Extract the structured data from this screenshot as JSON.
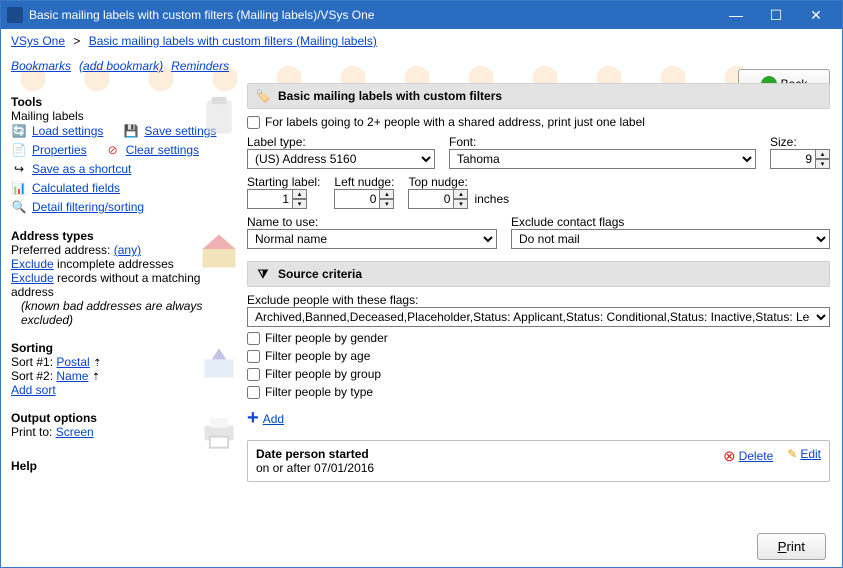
{
  "window": {
    "title": "Basic mailing labels with custom filters (Mailing labels)/VSys One"
  },
  "breadcrumb": {
    "root": "VSys One",
    "current": "Basic mailing labels with custom filters (Mailing labels)"
  },
  "bookmarks": {
    "bookmarks": "Bookmarks",
    "add": "(add bookmark)",
    "reminders": "Reminders"
  },
  "back": {
    "label": "Back"
  },
  "tools": {
    "heading": "Tools",
    "sub": "Mailing labels",
    "load": "Load settings",
    "save": "Save settings",
    "properties": "Properties",
    "clear": "Clear settings",
    "shortcut": "Save as a shortcut",
    "calc": "Calculated fields",
    "filter": "Detail filtering/sorting"
  },
  "address": {
    "heading": "Address types",
    "pref_label": "Preferred address:",
    "pref_value": "(any)",
    "exclude_link1": "Exclude",
    "exclude_txt1": " incomplete addresses",
    "exclude_link2": "Exclude",
    "exclude_txt2": " records without a matching address",
    "note": "(known bad addresses are always excluded)"
  },
  "sorting": {
    "heading": "Sorting",
    "s1_label": "Sort #1: ",
    "s1_value": "Postal",
    "s2_label": "Sort #2: ",
    "s2_value": "Name",
    "add": "Add sort"
  },
  "output": {
    "heading": "Output options",
    "label": "Print to: ",
    "value": "Screen"
  },
  "help": {
    "heading": "Help"
  },
  "main": {
    "header": "Basic mailing labels with custom filters",
    "share_chk": "For labels going to 2+ people with a shared address, print just one label",
    "label_type_lbl": "Label type:",
    "label_type_val": "(US) Address 5160",
    "font_lbl": "Font:",
    "font_val": "Tahoma",
    "size_lbl": "Size:",
    "size_val": "9",
    "start_lbl": "Starting label:",
    "start_val": "1",
    "leftn_lbl": "Left nudge:",
    "leftn_val": "0",
    "topn_lbl": "Top nudge:",
    "topn_val": "0",
    "nudge_unit": "inches",
    "name_lbl": "Name to use:",
    "name_val": "Normal name",
    "exflag_lbl": "Exclude contact flags",
    "exflag_val": "Do not mail"
  },
  "source": {
    "header": "Source criteria",
    "excl_lbl": "Exclude people with these flags:",
    "excl_val": "Archived,Banned,Deceased,Placeholder,Status: Applicant,Status: Conditional,Status: Inactive,Status: Leave of",
    "f_gender": "Filter people by gender",
    "f_age": "Filter people by age",
    "f_group": "Filter people by group",
    "f_type": "Filter people by type",
    "add": "Add",
    "crit_title": "Date person started",
    "crit_detail": "on or after 07/01/2016",
    "delete": "Delete",
    "edit": "Edit"
  },
  "footer": {
    "print": "Print"
  }
}
